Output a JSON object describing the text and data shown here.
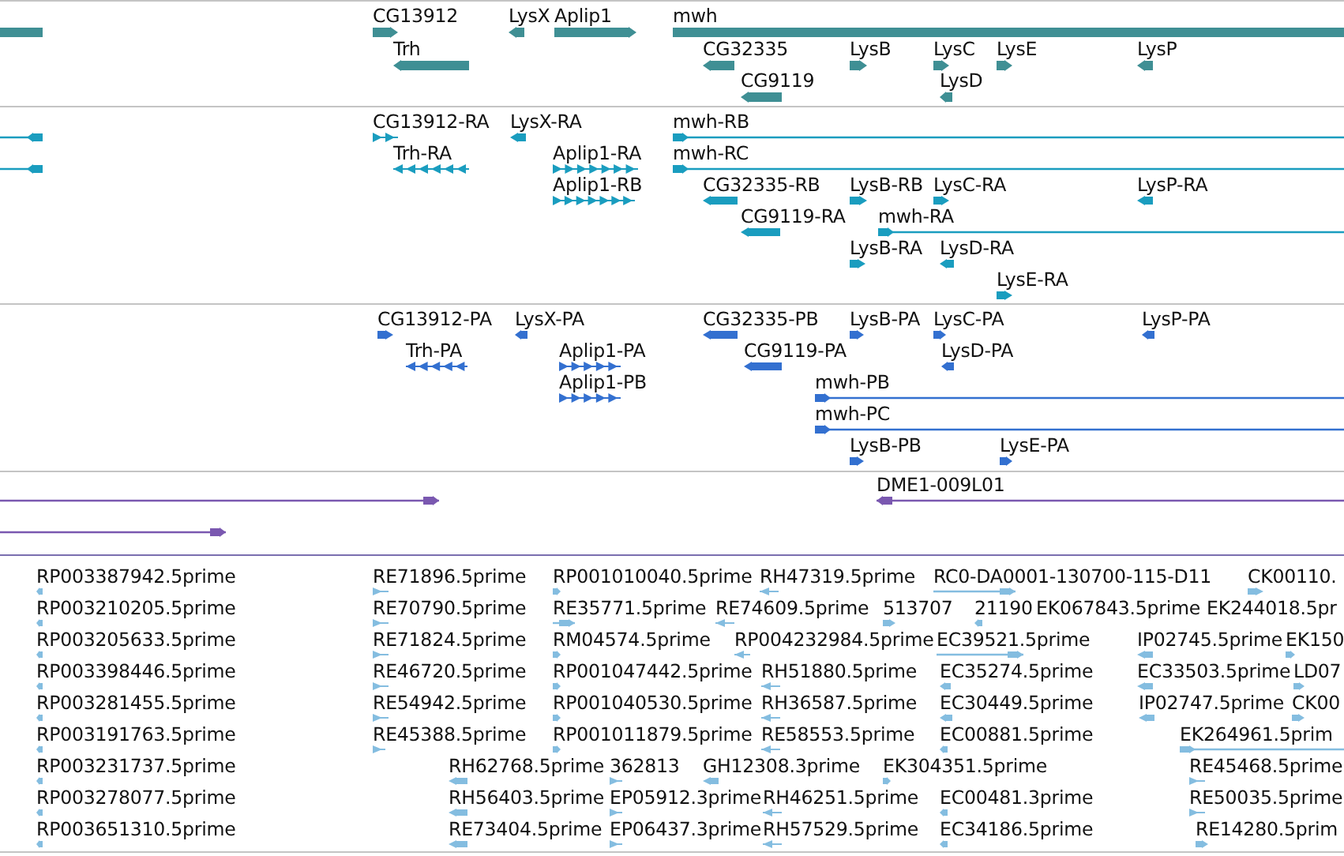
{
  "tracks": [
    {
      "kind": "gene",
      "features": [
        {
          "reverse": true
        },
        {
          "label": "CG13912",
          "reverse": false
        },
        {
          "label": "LysX",
          "reverse": true
        },
        {
          "label": "Aplip1",
          "reverse": false
        },
        {
          "label": "mwh",
          "reverse": false
        },
        {
          "label": "Trh",
          "reverse": true
        },
        {
          "label": "CG32335",
          "reverse": true
        },
        {
          "label": "LysB",
          "reverse": false
        },
        {
          "label": "LysC",
          "reverse": false
        },
        {
          "label": "LysE",
          "reverse": false
        },
        {
          "label": "LysP",
          "reverse": true
        },
        {
          "label": "CG9119",
          "reverse": true
        },
        {
          "label": "LysD",
          "reverse": true
        }
      ]
    },
    {
      "kind": "transcript",
      "features": [
        {
          "reverse": true
        },
        {
          "label": "CG13912-RA",
          "reverse": false
        },
        {
          "label": "LysX-RA",
          "reverse": true
        },
        {
          "label": "mwh-RB",
          "reverse": false
        },
        {
          "reverse": true
        },
        {
          "label": "Trh-RA",
          "reverse": true
        },
        {
          "label": "Aplip1-RA",
          "reverse": false
        },
        {
          "label": "mwh-RC",
          "reverse": false
        },
        {
          "label": "Aplip1-RB",
          "reverse": false
        },
        {
          "label": "CG32335-RB",
          "reverse": true
        },
        {
          "label": "LysB-RB",
          "reverse": false
        },
        {
          "label": "LysC-RA",
          "reverse": false
        },
        {
          "label": "LysP-RA",
          "reverse": true
        },
        {
          "label": "CG9119-RA",
          "reverse": true
        },
        {
          "label": "mwh-RA",
          "reverse": false
        },
        {
          "label": "LysB-RA",
          "reverse": false
        },
        {
          "label": "LysD-RA",
          "reverse": true
        },
        {
          "label": "LysE-RA",
          "reverse": false
        }
      ]
    },
    {
      "kind": "protein",
      "features": [
        {
          "label": "CG13912-PA",
          "reverse": false
        },
        {
          "label": "LysX-PA",
          "reverse": true
        },
        {
          "label": "CG32335-PB",
          "reverse": true
        },
        {
          "label": "LysB-PA",
          "reverse": false
        },
        {
          "label": "LysC-PA",
          "reverse": false
        },
        {
          "label": "LysP-PA",
          "reverse": true
        },
        {
          "label": "Trh-PA",
          "reverse": true
        },
        {
          "label": "Aplip1-PA",
          "reverse": false
        },
        {
          "label": "CG9119-PA",
          "reverse": true
        },
        {
          "label": "LysD-PA",
          "reverse": true
        },
        {
          "label": "Aplip1-PB",
          "reverse": false
        },
        {
          "label": "mwh-PB",
          "reverse": false
        },
        {
          "label": "mwh-PC",
          "reverse": false
        },
        {
          "label": "LysB-PB",
          "reverse": false
        },
        {
          "label": "LysE-PA",
          "reverse": false
        }
      ]
    },
    {
      "kind": "clone",
      "features": [
        {
          "reverse": false
        },
        {
          "label": "DME1-009L01",
          "reverse": true
        },
        {
          "reverse": false
        }
      ]
    },
    {
      "kind": "est",
      "features": [
        {
          "label": "RP003387942.5prime",
          "reverse": true
        },
        {
          "label": "RE71896.5prime",
          "reverse": false
        },
        {
          "label": "RP001010040.5prime",
          "reverse": false
        },
        {
          "label": "RH47319.5prime",
          "reverse": true
        },
        {
          "label": "RC0-DA0001-130700-115-D11",
          "reverse": false
        },
        {
          "label": "CK00110.",
          "reverse": false
        },
        {
          "label": "RP003210205.5prime",
          "reverse": true
        },
        {
          "label": "RE70790.5prime",
          "reverse": false
        },
        {
          "label": "RE35771.5prime",
          "reverse": false
        },
        {
          "label": "RE74609.5prime",
          "reverse": true
        },
        {
          "label": "513707",
          "reverse": false
        },
        {
          "label": "21190",
          "reverse": true
        },
        {
          "label": "EK067843.5prime"
        },
        {
          "label": "EK244018.5pr"
        },
        {
          "label": "RP003205633.5prime",
          "reverse": true
        },
        {
          "label": "RE71824.5prime",
          "reverse": false
        },
        {
          "label": "RM04574.5prime",
          "reverse": false
        },
        {
          "label": "RP004232984.5prime",
          "reverse": true
        },
        {
          "label": "EC39521.5prime",
          "reverse": false
        },
        {
          "label": "IP02745.5prime",
          "reverse": true
        },
        {
          "label": "EK150",
          "reverse": false
        },
        {
          "label": "RP003398446.5prime",
          "reverse": true
        },
        {
          "label": "RE46720.5prime",
          "reverse": false
        },
        {
          "label": "RP001047442.5prime",
          "reverse": false
        },
        {
          "label": "RH51880.5prime",
          "reverse": true
        },
        {
          "label": "EC35274.5prime",
          "reverse": true
        },
        {
          "label": "EC33503.5prime",
          "reverse": true
        },
        {
          "label": "LD07",
          "reverse": false
        },
        {
          "label": "RP003281455.5prime",
          "reverse": true
        },
        {
          "label": "RE54942.5prime",
          "reverse": false
        },
        {
          "label": "RP001040530.5prime",
          "reverse": false
        },
        {
          "label": "RH36587.5prime",
          "reverse": true
        },
        {
          "label": "EC30449.5prime",
          "reverse": true
        },
        {
          "label": "IP02747.5prime",
          "reverse": true
        },
        {
          "label": "CK00",
          "reverse": false
        },
        {
          "label": "RP003191763.5prime",
          "reverse": true
        },
        {
          "label": "RE45388.5prime",
          "reverse": false
        },
        {
          "label": "RP001011879.5prime",
          "reverse": false
        },
        {
          "label": "RE58553.5prime",
          "reverse": true
        },
        {
          "label": "EC00881.5prime",
          "reverse": true
        },
        {
          "label": "EK264961.5prim",
          "reverse": false
        },
        {
          "label": "RP003231737.5prime",
          "reverse": true
        },
        {
          "label": "RH62768.5prime",
          "reverse": true
        },
        {
          "label": "362813",
          "reverse": false
        },
        {
          "label": "GH12308.3prime",
          "reverse": true
        },
        {
          "label": "EK304351.5prime",
          "reverse": false
        },
        {
          "label": "RE45468.5prime",
          "reverse": false
        },
        {
          "label": "RP003278077.5prime",
          "reverse": true
        },
        {
          "label": "RH56403.5prime",
          "reverse": true
        },
        {
          "label": "EP05912.3prime",
          "reverse": false
        },
        {
          "label": "RH46251.5prime",
          "reverse": true
        },
        {
          "label": "EC00481.3prime",
          "reverse": true
        },
        {
          "label": "RE50035.5prime",
          "reverse": false
        },
        {
          "label": "RP003651310.5prime",
          "reverse": true
        },
        {
          "label": "RE73404.5prime",
          "reverse": true
        },
        {
          "label": "EP06437.3prime",
          "reverse": false
        },
        {
          "label": "RH57529.5prime",
          "reverse": true
        },
        {
          "label": "EC34186.5prime",
          "reverse": true
        },
        {
          "label": "RE14280.5prim",
          "reverse": false
        }
      ]
    }
  ]
}
